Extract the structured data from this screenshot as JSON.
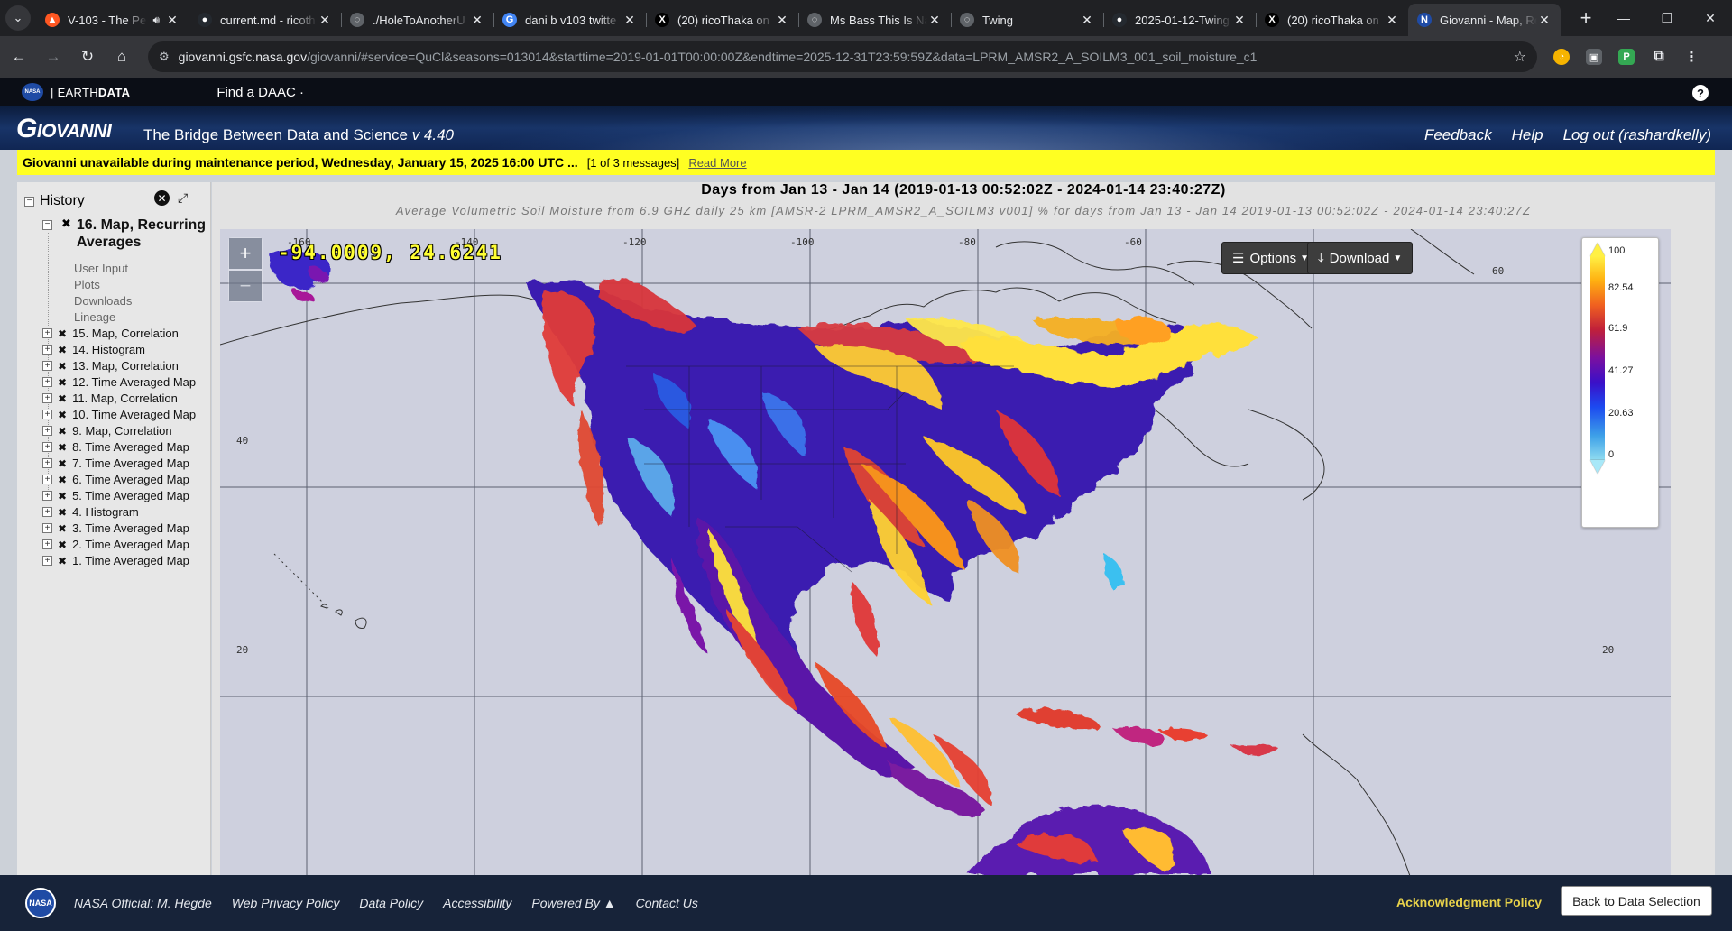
{
  "browser": {
    "tabs": [
      {
        "title": "V-103 - The Pe",
        "favicon_color": "#ff5722",
        "favicon_glyph": "▲",
        "audio": true
      },
      {
        "title": "current.md - ricoth",
        "favicon_color": "#24292f",
        "favicon_glyph": "●"
      },
      {
        "title": "./HoleToAnotherU",
        "favicon_color": "#5f6368",
        "favicon_glyph": "◌"
      },
      {
        "title": "dani b v103 twitte",
        "favicon_color": "#4285f4",
        "favicon_glyph": "G"
      },
      {
        "title": "(20) ricoThaka on",
        "favicon_color": "#000000",
        "favicon_glyph": "X"
      },
      {
        "title": "Ms Bass This Is Na",
        "favicon_color": "#5f6368",
        "favicon_glyph": "◌"
      },
      {
        "title": "Twing",
        "favicon_color": "#5f6368",
        "favicon_glyph": "◌"
      },
      {
        "title": "2025-01-12-Twing",
        "favicon_color": "#24292f",
        "favicon_glyph": "●"
      },
      {
        "title": "(20) ricoThaka on",
        "favicon_color": "#000000",
        "favicon_glyph": "X"
      },
      {
        "title": "Giovanni - Map, Re",
        "favicon_color": "#1f4ba5",
        "favicon_glyph": "N",
        "active": true
      }
    ],
    "url_host": "giovanni.gsfc.nasa.gov",
    "url_rest": "/giovanni/#service=QuCl&seasons=013014&starttime=2019-01-01T00:00:00Z&endtime=2025-12-31T23:59:59Z&data=LPRM_AMSR2_A_SOILM3_001_soil_moisture_c1"
  },
  "earthdata": {
    "brand_prefix": "| EARTH",
    "brand_bold": "DATA",
    "find_daac": "Find a DAAC ·"
  },
  "header": {
    "logo": "Giovanni",
    "tagline": "The Bridge Between Data and Science",
    "version": "v 4.40",
    "links": [
      "Feedback",
      "Help",
      "Log out (rashardkelly)"
    ]
  },
  "banner": {
    "message": "Giovanni unavailable during maintenance period, Wednesday, January 15, 2025 16:00 UTC ...",
    "count": "[1 of 3 messages]",
    "read_more": "Read More"
  },
  "sidebar": {
    "title": "History",
    "current_item": "16. Map, Recurring Averages",
    "current_children": [
      "User Input",
      "Plots",
      "Downloads",
      "Lineage"
    ],
    "items": [
      "15. Map, Correlation",
      "14. Histogram",
      "13. Map, Correlation",
      "12. Time Averaged Map",
      "11. Map, Correlation",
      "10. Time Averaged Map",
      "9. Map, Correlation",
      "8. Time Averaged Map",
      "7. Time Averaged Map",
      "6. Time Averaged Map",
      "5. Time Averaged Map",
      "4. Histogram",
      "3. Time Averaged Map",
      "2. Time Averaged Map",
      "1. Time Averaged Map"
    ]
  },
  "plot": {
    "title": "Days from Jan 13 - Jan 14 (2019-01-13 00:52:02Z - 2024-01-14 23:40:27Z)",
    "subtitle": "Average Volumetric Soil Moisture from 6.9 GHZ daily 25 km [AMSR-2 LPRM_AMSR2_A_SOILM3 v001] % for days from Jan 13 - Jan 14 2019-01-13 00:52:02Z - 2024-01-14 23:40:27Z",
    "cursor_readout": "-94.0009, 24.6241",
    "options_label": "Options",
    "download_label": "Download",
    "lon_labels": [
      "-160",
      "-140",
      "-120",
      "-100",
      "-80",
      "-60"
    ],
    "lat_labels": [
      "60",
      "40",
      "20"
    ],
    "legend_ticks": [
      "100",
      "82.54",
      "61.9",
      "41.27",
      "20.63",
      "0"
    ]
  },
  "footer": {
    "official": "NASA Official: M. Hegde",
    "links": [
      "Web Privacy Policy",
      "Data Policy",
      "Accessibility",
      "Powered By ▲",
      "Contact Us"
    ],
    "acknowledgment": "Acknowledgment Policy",
    "back_button": "Back to Data Selection"
  }
}
